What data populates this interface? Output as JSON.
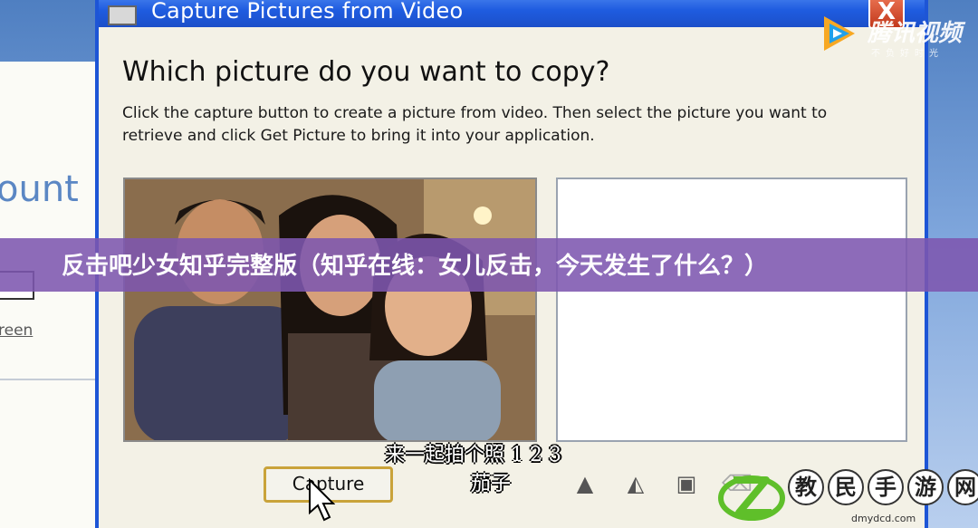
{
  "window": {
    "title": "Capture Pictures from Video",
    "close_label": "X"
  },
  "background_window": {
    "partial_heading": "ount",
    "partial_link": "reen"
  },
  "dialog": {
    "heading": "Which picture do you want to copy?",
    "instructions": "Click the capture button to create a picture from video. Then select the picture you want to retrieve and click Get Picture to bring it into your application.",
    "capture_label": "Capture"
  },
  "toolbar_icons": [
    "flip-icon",
    "mirror-icon",
    "properties-icon",
    "clear-icon"
  ],
  "overlay": {
    "banner_text": "反击吧少女知乎完整版（知乎在线：女儿反击，今天发生了什么？）",
    "subtitle_line1": "来一起拍个照 1 2 3",
    "subtitle_line2": "茄子"
  },
  "watermarks": {
    "tencent_name": "腾讯视频",
    "tencent_slogan": "不负好时光",
    "site_chars": [
      "教",
      "民",
      "手",
      "游",
      "网"
    ],
    "site_url": "dmydcd.com"
  },
  "colors": {
    "titlebar": "#1f5ce0",
    "dialog_bg": "#f3f1e6",
    "banner": "#7d57af",
    "capture_border": "#c9a33a"
  }
}
